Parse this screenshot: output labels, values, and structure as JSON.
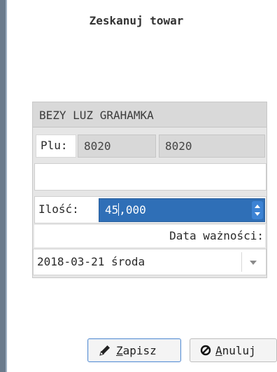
{
  "dialog": {
    "title": "Zeskanuj towar"
  },
  "product": {
    "name": "BEZY LUZ GRAHAMKA"
  },
  "plu": {
    "label": "Plu:",
    "value_1": "8020",
    "value_2": "8020"
  },
  "quantity": {
    "label": "Ilość:",
    "value_before_caret": "45",
    "value_after_caret": ",000"
  },
  "expiry": {
    "label": "Data ważności:",
    "value": "2018-03-21 środa"
  },
  "buttons": {
    "save_mnemonic": "Z",
    "save_rest": "apisz",
    "cancel_mnemonic": "A",
    "cancel_rest": "nuluj"
  },
  "colors": {
    "accent": "#2f6fb7",
    "panel": "#e6e6e6",
    "edge": "#6b7b8c"
  },
  "icons": {
    "save": "pencil-icon",
    "cancel": "cancel-circle-icon"
  }
}
